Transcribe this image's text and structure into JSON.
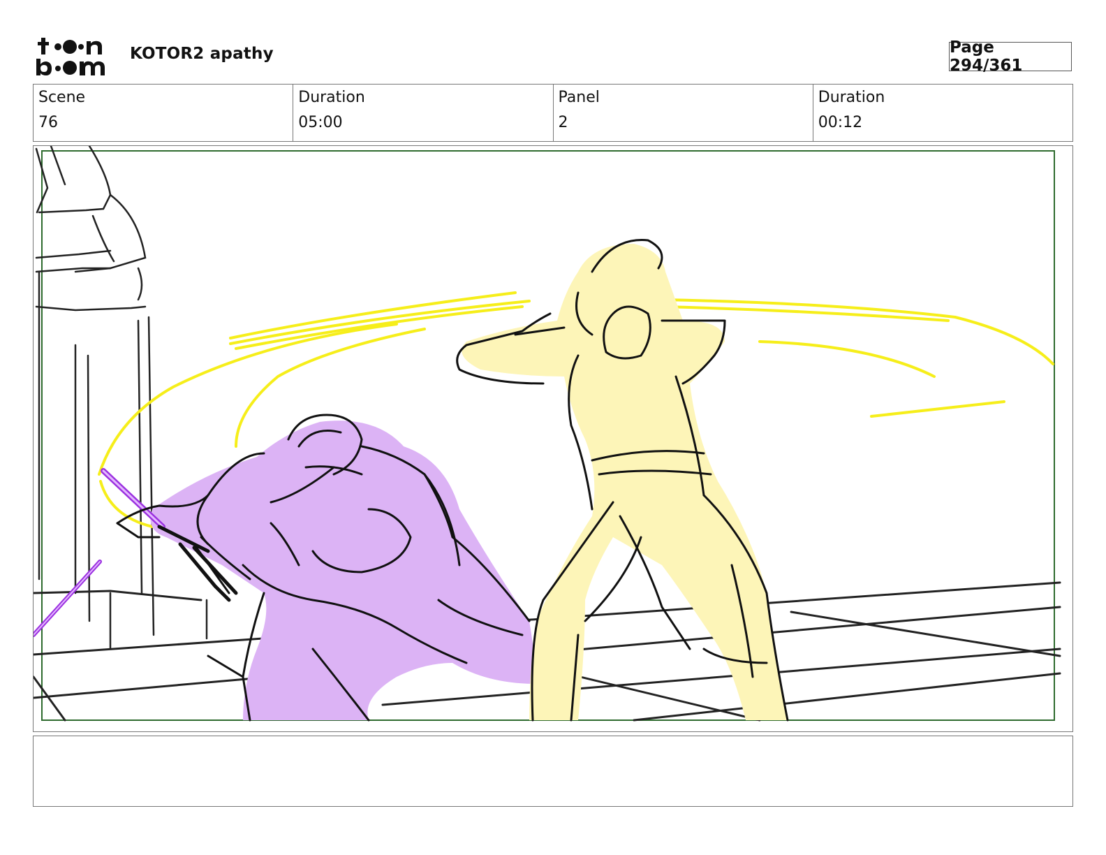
{
  "header": {
    "logo_text": "toon boom",
    "project_title": "KOTOR2 apathy",
    "page_label": "Page 294/361"
  },
  "info": {
    "scene_label": "Scene",
    "scene_value": "76",
    "scene_duration_label": "Duration",
    "scene_duration_value": "05:00",
    "panel_label": "Panel",
    "panel_value": "2",
    "panel_duration_label": "Duration",
    "panel_duration_value": "00:12"
  },
  "panel": {
    "colors": {
      "safe_frame": "#2e6b2e",
      "purple_fill": "#dcb3f5",
      "purple_saber": "#9b30e0",
      "yellow_fill": "#fdf5b8",
      "yellow_saber": "#f6ee1a",
      "ink": "#111111"
    }
  },
  "notes": {
    "text": ""
  }
}
